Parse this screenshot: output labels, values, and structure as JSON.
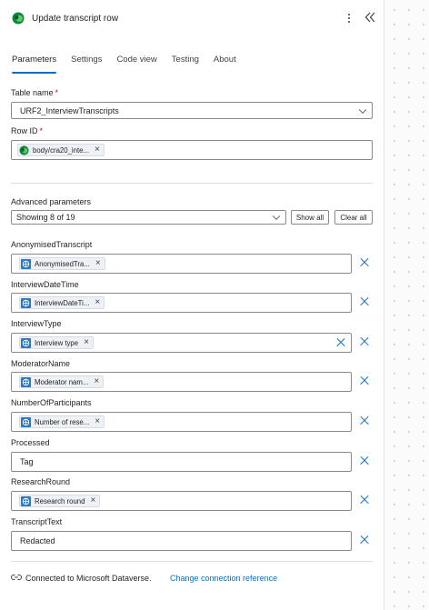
{
  "header": {
    "title": "Update transcript row",
    "icon": "dataverse-icon",
    "more_icon": "more-vertical-icon",
    "collapse_icon": "double-chevron-left-icon"
  },
  "tabs": [
    {
      "label": "Parameters",
      "active": true
    },
    {
      "label": "Settings",
      "active": false
    },
    {
      "label": "Code view",
      "active": false
    },
    {
      "label": "Testing",
      "active": false
    },
    {
      "label": "About",
      "active": false
    }
  ],
  "table_name": {
    "label": "Table name",
    "required": "*",
    "value": "URF2_InterviewTranscripts"
  },
  "row_id": {
    "label": "Row ID",
    "required": "*",
    "token": "body/cra20_inte..."
  },
  "advanced": {
    "label": "Advanced parameters",
    "showing": "Showing 8 of 19",
    "show_all": "Show all",
    "clear_all": "Clear all"
  },
  "params": [
    {
      "label": "AnonymisedTranscript",
      "token": "AnonymisedTra..."
    },
    {
      "label": "InterviewDateTime",
      "token": "InterviewDateTi..."
    },
    {
      "label": "InterviewType",
      "token": "Interview type"
    },
    {
      "label": "ModeratorName",
      "token": "Moderator nam..."
    },
    {
      "label": "NumberOfParticipants",
      "token": "Number of rese..."
    },
    {
      "label": "Processed",
      "value": "Tag"
    },
    {
      "label": "ResearchRound",
      "token": "Research round"
    },
    {
      "label": "TranscriptText",
      "value": "Redacted"
    }
  ],
  "footer": {
    "text": "Connected to Microsoft Dataverse.",
    "link": "Change connection reference"
  },
  "colors": {
    "accent": "#0f6cbd",
    "token_icon": "#2a78c8",
    "required": "#c50f1f"
  }
}
